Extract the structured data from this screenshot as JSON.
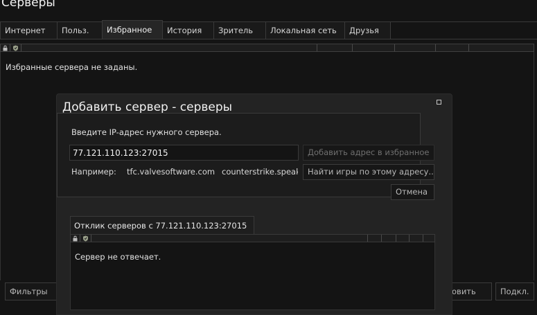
{
  "window": {
    "title": "Серверы"
  },
  "tabs": [
    {
      "label": "Интернет"
    },
    {
      "label": "Польз."
    },
    {
      "label": "Избранное",
      "active": true
    },
    {
      "label": "История"
    },
    {
      "label": "Зритель"
    },
    {
      "label": "Локальная сеть"
    },
    {
      "label": "Друзья"
    }
  ],
  "favorites": {
    "empty_message": "Избранные сервера не заданы."
  },
  "bottom": {
    "filters_label": "Фильтры",
    "refresh_label_partial": "овить",
    "connect_label": "Подкл."
  },
  "dialog": {
    "title": "Добавить сервер - серверы",
    "prompt": "Введите IP-адрес нужного сервера.",
    "ip_value": "77.121.110.123:27015",
    "example_label": "Например:",
    "examples": [
      "tfc.valvesoftware.com",
      "counterstrike.speakeasy.net"
    ],
    "add_favorite_label": "Добавить адрес в избранное",
    "find_games_label": "Найти игры по этому адресу...",
    "cancel_label": "Отмена",
    "response_title": "Отклик серверов с 77.121.110.123:27015",
    "response_message": "Сервер не отвечает."
  },
  "icons": {
    "lock": "lock-icon",
    "shield": "shield-icon",
    "close": "maximize-icon"
  },
  "colors": {
    "background": "#141414",
    "panel": "#232323",
    "border": "#3a3a3a",
    "text": "#dcdcdc",
    "disabled_text": "#6f6f6f"
  }
}
